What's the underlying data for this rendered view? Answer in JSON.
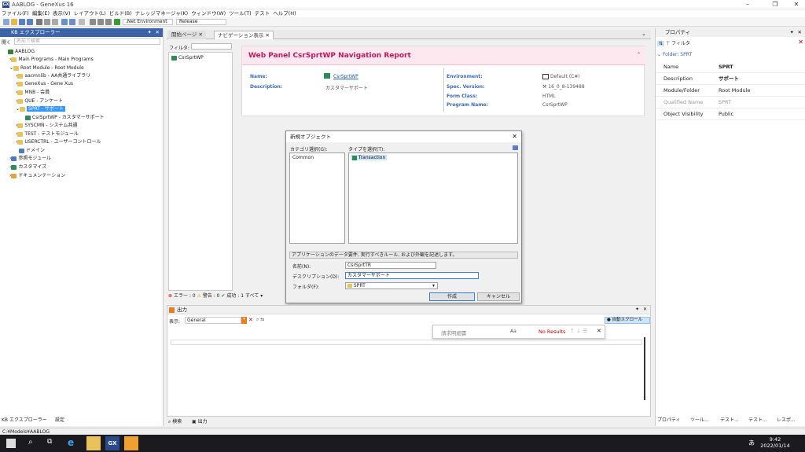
{
  "window": {
    "title": "AABLOG - GeneXus 16",
    "logo": "GX"
  },
  "menu": [
    "ファイル(F)",
    "編集(E)",
    "表示(V)",
    "レイアウト(L)",
    "ビルド(B)",
    "ナレッジマネージャ(K)",
    "ウィンドウ(W)",
    "ツール(T)",
    "テスト",
    "ヘルプ(H)"
  ],
  "toolbar": {
    "environment": ".Net Environment",
    "config": "Release"
  },
  "kb": {
    "title": "KB エクスプローラー",
    "open_label": "開く",
    "search_placeholder": "名前で検索",
    "tree": [
      "AABLOG",
      "Main Programs - Main Programs",
      "Root Module - Root Module",
      "aacmnlib - AA共通ライブラリ",
      "GeneXus - Gene Xus",
      "MNB - 会員",
      "QUE - アンケート",
      "SPRT - サポート",
      "CsrSprtWP - カスタマーサポート",
      "SYSCMN - システム共通",
      "TEST - テストモジュール",
      "USERCTRL - ユーザーコントロール",
      "ドメイン",
      "参照モジュール",
      "カスタマイズ",
      "ドキュメンテーション"
    ],
    "bottom_tabs": [
      "KB エクスプローラー",
      "設定"
    ]
  },
  "doc": {
    "tabs": [
      "開始ページ",
      "ナビゲーション表示"
    ],
    "filter_label": "フィルタ:",
    "nav_item": "CsrSprtWP",
    "report_title": "Web Panel CsrSprtWP Navigation Report",
    "name_label": "Name:",
    "name_value": "CsrSprtWP",
    "desc_label": "Description:",
    "desc_value": "カスタマーサポート",
    "env_label": "Environment:",
    "env_value": "Default (C#)",
    "spec_label": "Spec. Version:",
    "spec_value": "16_0_8-139488",
    "form_label": "Form Class:",
    "form_value": "HTML",
    "prog_label": "Program Name:",
    "prog_value": "CsrSprtWP",
    "status": {
      "errors": "エラー : 0",
      "warnings": "警告 : 0",
      "success": "成功 : 1",
      "all": "すべて"
    }
  },
  "dialog": {
    "title": "新規オブジェクト",
    "category_label": "カテゴリ選択(G):",
    "type_label": "タイプを選択(T):",
    "categories": [
      "Common"
    ],
    "types": [
      "Transaction"
    ],
    "hint": "アプリケーションのデータ要件, 実行すべきルール, および外観を記述します。",
    "name_label": "名前(N):",
    "name_value": "CsrSprtTR",
    "desc_label": "デスクリプション(D):",
    "desc_value": "カスタマーサポート",
    "folder_label": "フォルダ(F):",
    "folder_value": "SPRT",
    "create_label": "作成",
    "cancel_label": "キャンセル"
  },
  "output": {
    "title": "出力",
    "show_label": "表示:",
    "show_value": "General",
    "auto_scroll": "自動スクロール",
    "search_placeholder": "請求明細書",
    "search_case": "Aa",
    "no_results": "No Results",
    "bottom_tabs": [
      "検索",
      "出力"
    ]
  },
  "props": {
    "title": "プロパティ",
    "filter_label": "フィルタ",
    "folder_header": "Folder: SPRT",
    "rows": [
      {
        "k": "Name",
        "v": "SPRT",
        "bold": true
      },
      {
        "k": "Description",
        "v": "サポート",
        "bold": true
      },
      {
        "k": "Module/Folder",
        "v": "Root Module",
        "bold": false
      },
      {
        "k": "Qualified Name",
        "v": "SPRT",
        "bold": false,
        "dim": true
      },
      {
        "k": "Object Visibility",
        "v": "Public",
        "bold": false
      }
    ],
    "bottom_tabs": [
      "プロパティ",
      "ツール...",
      "テスト...",
      "テスト...",
      "レスポ..."
    ]
  },
  "statusbar": "C:¥Models¥AABLOG",
  "taskbar": {
    "time": "9:42",
    "date": "2022/01/14",
    "ime": "あ",
    "gx": "GX"
  },
  "colors": {
    "accent": "#3a63a8",
    "report_title": "#c0185e",
    "label_blue": "#3c6ab2",
    "selection": "#3399ff"
  }
}
